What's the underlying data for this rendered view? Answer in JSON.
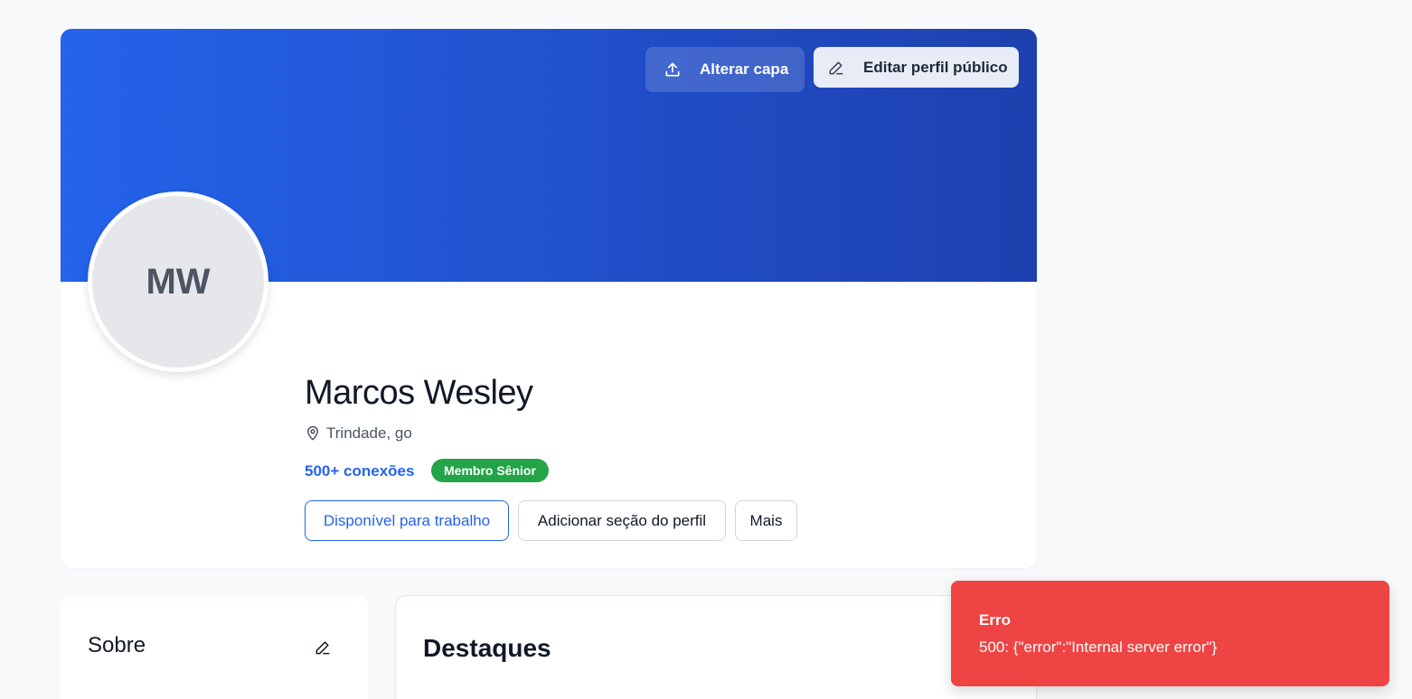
{
  "header": {
    "change_cover_label": "Alterar capa",
    "edit_public_profile_label": "Editar perfil público"
  },
  "profile": {
    "initials": "MW",
    "name": "Marcos Wesley",
    "location": "Trindade, go",
    "connections": "500+ conexões",
    "badge": "Membro Sênior"
  },
  "actions": {
    "available_label": "Disponível para trabalho",
    "add_section_label": "Adicionar seção do perfil",
    "more_label": "Mais"
  },
  "sections": {
    "about_title": "Sobre",
    "highlights_title": "Destaques"
  },
  "toast": {
    "title": "Erro",
    "message": "500: {\"error\":\"Internal server error\"}"
  },
  "icons": {
    "upload": "upload-icon",
    "pencil": "pencil-icon",
    "location": "map-pin-icon"
  },
  "colors": {
    "accent": "#2563eb",
    "cover_start": "#2563eb",
    "cover_end": "#1e40af",
    "badge": "#22a447",
    "error": "#ef4444"
  }
}
